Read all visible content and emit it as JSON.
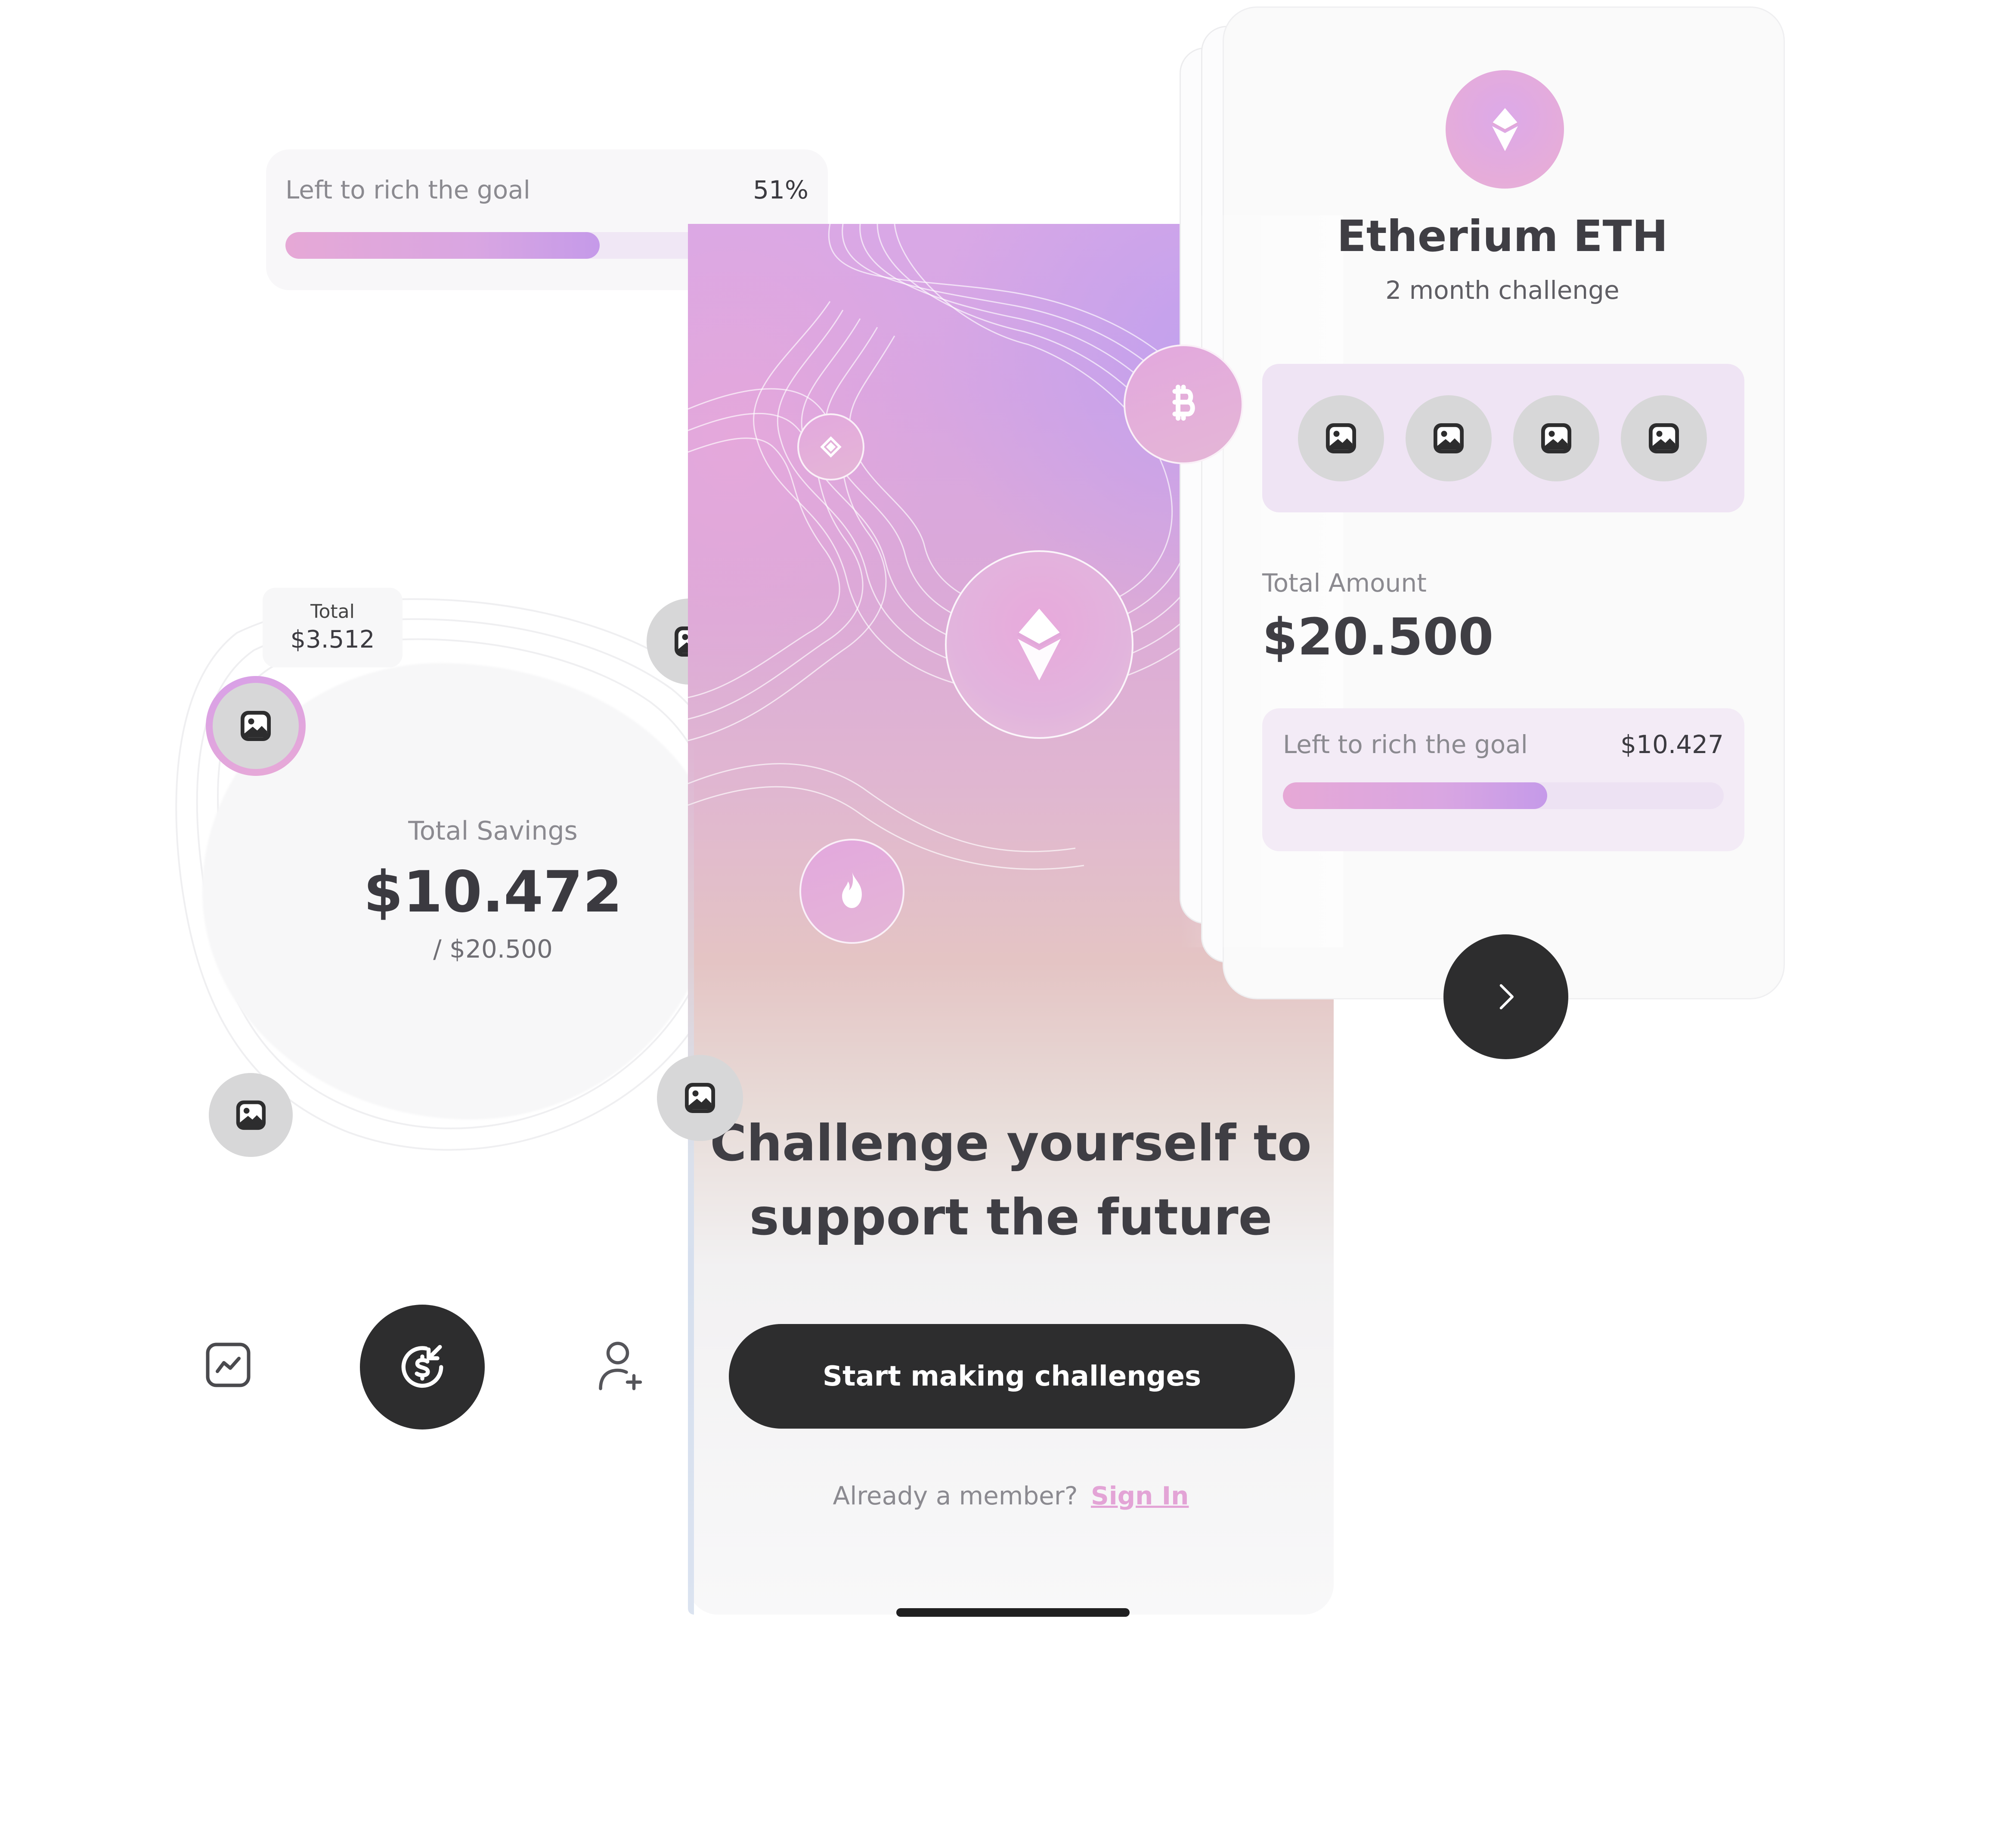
{
  "goal_card": {
    "label": "Left to rich the goal",
    "percent": "51%",
    "progress": 0.6
  },
  "savings": {
    "mini_total_label": "Total",
    "mini_total_value": "$3.512",
    "label": "Total Savings",
    "value": "$10.472",
    "target": "/ $20.500"
  },
  "onboarding": {
    "headline_line1": "Challenge yourself to",
    "headline_line2": "support the future",
    "cta": "Start making challenges",
    "member_text": "Already a member?",
    "sign_in": "Sign In"
  },
  "challenge_card": {
    "title": "Etherium ETH",
    "subtitle": "2 month challenge",
    "total_amount_label": "Total Amount",
    "total_amount_value": "$20.500",
    "goal_label": "Left to rich the goal",
    "goal_value": "$10.427",
    "goal_progress": 0.6
  },
  "icons": {
    "nav": [
      "chart-icon",
      "dollar-refresh-icon",
      "add-user-icon"
    ],
    "coins": [
      "ethereum-icon",
      "binance-icon",
      "fire-icon",
      "bitcoin-icon"
    ],
    "placeholder": "image-placeholder-icon",
    "next": "chevron-right-icon"
  },
  "colors": {
    "accent_pink": "#e3a4d6",
    "accent_purple": "#c59ae9",
    "dark": "#2d2d2e",
    "text_primary": "#3f3e44",
    "text_muted": "#8b8a90"
  }
}
